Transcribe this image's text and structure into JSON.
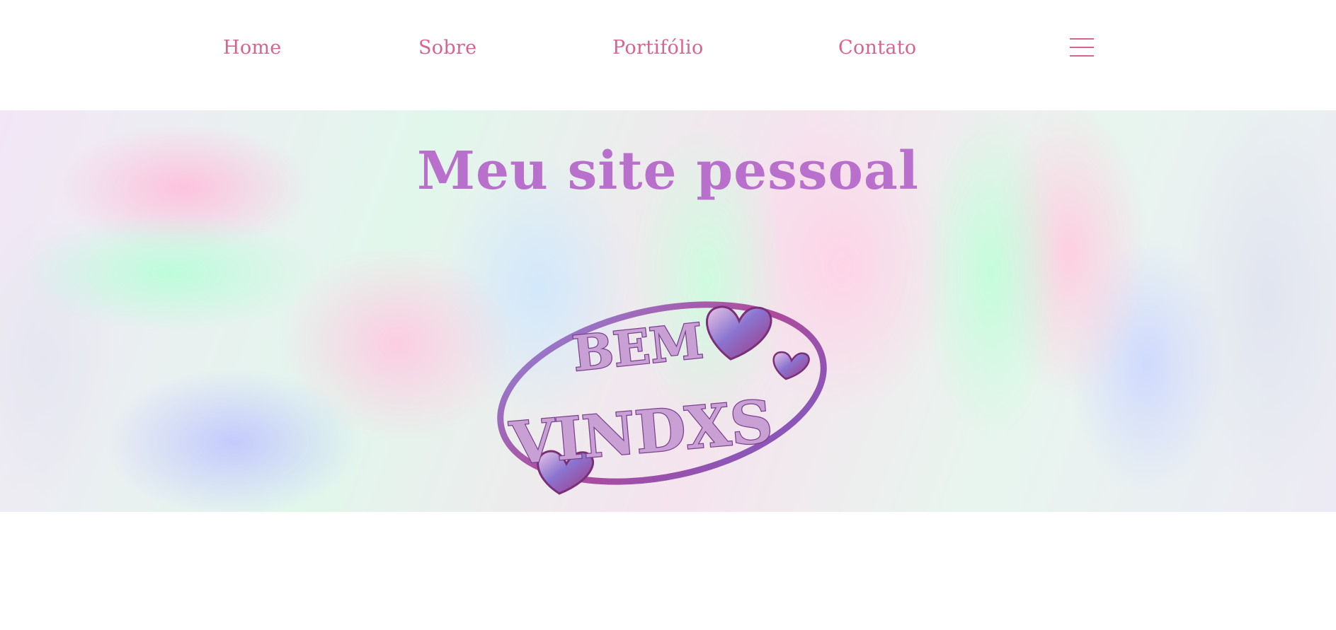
{
  "nav": {
    "items": [
      {
        "label": "Home"
      },
      {
        "label": "Sobre"
      },
      {
        "label": "Portifólio"
      },
      {
        "label": "Contato"
      }
    ],
    "menu_icon": "hamburger-menu-icon",
    "link_color": "#d9638f"
  },
  "hero": {
    "title": "Meu site pessoal",
    "title_color": "#b96fcc",
    "welcome_line1": "BEM",
    "welcome_line2": "VINDXS"
  }
}
